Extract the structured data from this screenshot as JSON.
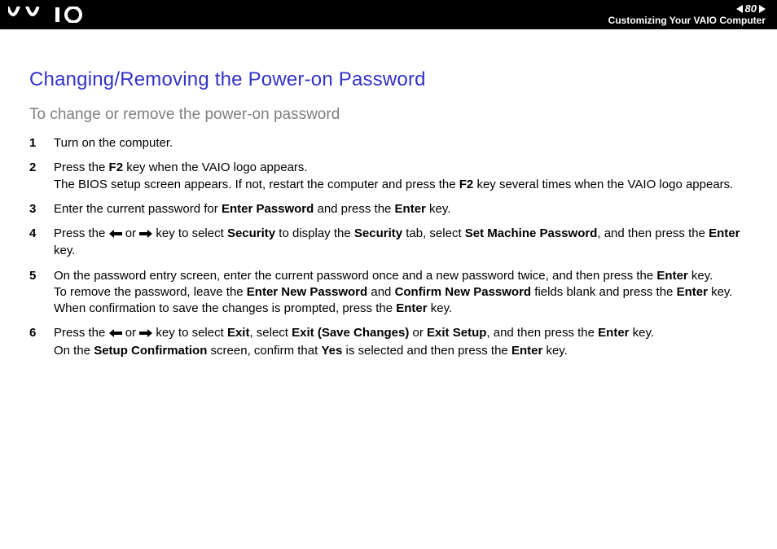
{
  "header": {
    "page_number": "80",
    "breadcrumb": "Customizing Your VAIO Computer"
  },
  "title": "Changing/Removing the Power-on Password",
  "subtitle": "To change or remove the power-on password",
  "steps": {
    "s1": "Turn on the computer.",
    "s2a": "Press the ",
    "s2b": "F2",
    "s2c": " key when the VAIO logo appears.",
    "s2d": "The BIOS setup screen appears. If not, restart the computer and press the ",
    "s2e": "F2",
    "s2f": " key several times when the VAIO logo appears.",
    "s3a": "Enter the current password for ",
    "s3b": "Enter Password",
    "s3c": " and press the ",
    "s3d": "Enter",
    "s3e": " key.",
    "s4a": "Press the ",
    "s4b": " or ",
    "s4c": " key to select ",
    "s4d": "Security",
    "s4e": " to display the ",
    "s4f": "Security",
    "s4g": " tab, select ",
    "s4h": "Set Machine Password",
    "s4i": ", and then press the ",
    "s4j": "Enter",
    "s4k": " key.",
    "s5a": "On the password entry screen, enter the current password once and a new password twice, and then press the ",
    "s5b": "Enter",
    "s5c": " key.",
    "s5d": "To remove the password, leave the ",
    "s5e": "Enter New Password",
    "s5f": " and ",
    "s5g": "Confirm New Password",
    "s5h": " fields blank and press the ",
    "s5i": "Enter",
    "s5j": " key.",
    "s5k": "When confirmation to save the changes is prompted, press the ",
    "s5l": "Enter",
    "s5m": " key.",
    "s6a": "Press the ",
    "s6b": " or ",
    "s6c": " key to select ",
    "s6d": "Exit",
    "s6e": ", select ",
    "s6f": "Exit (Save Changes)",
    "s6g": " or ",
    "s6h": "Exit Setup",
    "s6i": ", and then press the ",
    "s6j": "Enter",
    "s6k": " key.",
    "s6l": "On the ",
    "s6m": "Setup Confirmation",
    "s6n": " screen, confirm that ",
    "s6o": "Yes",
    "s6p": " is selected and then press the ",
    "s6q": "Enter",
    "s6r": " key."
  }
}
